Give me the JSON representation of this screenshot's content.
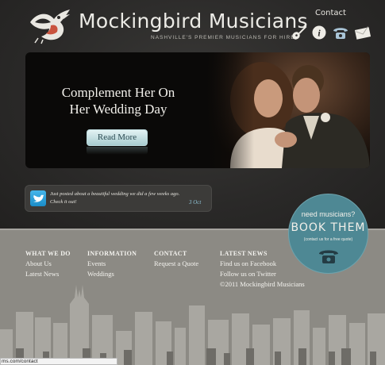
{
  "header": {
    "brand": "Mockingbird Musicians",
    "tagline": "NASHVILLE'S PREMIER MUSICIANS FOR HIRE",
    "contact_label": "Contact",
    "icons": [
      "guitar-icon",
      "info-icon",
      "phone-icon",
      "mail-icon"
    ]
  },
  "hero": {
    "title_line1": "Complement Her On",
    "title_line2": "Her Wedding Day",
    "read_more": "Read More"
  },
  "tweet": {
    "line1": "Just posted about a beautiful wedding we did a few weeks ago.",
    "line2": "Check it out!",
    "date": "3 Oct"
  },
  "badge": {
    "top": "need musicians?",
    "main": "BOOK THEM",
    "sub": "(contact us for a free quote)"
  },
  "footer": {
    "what_we_do": {
      "heading": "WHAT WE DO",
      "links": [
        "About Us",
        "Latest News"
      ]
    },
    "information": {
      "heading": "INFORMATION",
      "links": [
        "Events",
        "Weddings"
      ]
    },
    "contact": {
      "heading": "CONTACT",
      "links": [
        "Request a Quote"
      ]
    },
    "latest_news": {
      "heading": "LATEST NEWS",
      "links": [
        "Find us on Facebook",
        "Follow us on Twitter"
      ],
      "copyright": "©2011 Mockingbird Musicians"
    }
  },
  "status_url": "ms.com/contact",
  "colors": {
    "badge": "#4e8894",
    "button": "#a8cdd1",
    "footer": "#8c8a84",
    "header": "#2a2928"
  }
}
